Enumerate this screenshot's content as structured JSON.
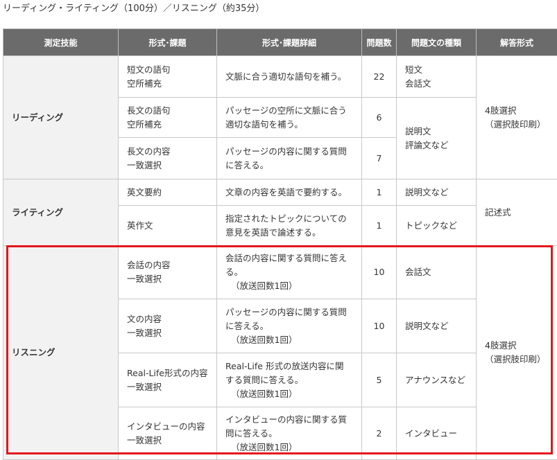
{
  "heading": "リーディング・ライティング（100分）／リスニング（約35分）",
  "columns": {
    "skill": "測定技能",
    "format": "形式･課題",
    "detail": "形式･課題詳細",
    "count": "問題数",
    "text_type": "問題文の種類",
    "answer": "解答形式"
  },
  "reading": {
    "skill": "リーディング",
    "answer_1": "4肢選択",
    "answer_2": "（選択肢印刷）",
    "rows": [
      {
        "format_1": "短文の語句",
        "format_2": "空所補充",
        "detail_1": "文脈に合う適切な語句を補う。",
        "count": "22",
        "type_1": "短文",
        "type_2": "会話文"
      },
      {
        "format_1": "長文の語句",
        "format_2": "空所補充",
        "detail_1": "パッセージの空所に文脈に合う",
        "detail_2": "適切な語句を補う。",
        "count": "6"
      },
      {
        "format_1": "長文の内容",
        "format_2": "一致選択",
        "detail_1": "パッセージの内容に関する質問",
        "detail_2": "に答える。",
        "count": "7"
      }
    ],
    "merged_type_1": "説明文",
    "merged_type_2": "評論文など"
  },
  "writing": {
    "skill": "ライティング",
    "answer": "記述式",
    "rows": [
      {
        "format_1": "英文要約",
        "detail_1": "文章の内容を英語で要約する。",
        "count": "1",
        "type_1": "説明文など"
      },
      {
        "format_1": "英作文",
        "detail_1": "指定されたトピックについての",
        "detail_2": "意見を英語で論述する。",
        "count": "1",
        "type_1": "トピックなど"
      }
    ]
  },
  "listening": {
    "skill": "リスニング",
    "answer_1": "4肢選択",
    "answer_2": "（選択肢印刷）",
    "rows": [
      {
        "format_1": "会話の内容",
        "format_2": "一致選択",
        "detail_1": "会話の内容に関する質問に答え",
        "detail_2": "る。",
        "detail_3": "（放送回数1回）",
        "count": "10",
        "type_1": "会話文"
      },
      {
        "format_1": "文の内容",
        "format_2": "一致選択",
        "detail_1": "パッセージの内容に関する質問",
        "detail_2": "に答える。",
        "detail_3": "（放送回数1回）",
        "count": "10",
        "type_1": "説明文など"
      },
      {
        "format_1": "Real-Life形式の内容",
        "format_2": "一致選択",
        "detail_1": "Real-Life 形式の放送内容に関",
        "detail_2": "する質問に答える。",
        "detail_3": "（放送回数1回）",
        "count": "5",
        "type_1": "アナウンスなど"
      },
      {
        "format_1": "インタビューの内容",
        "format_2": "一致選択",
        "detail_1": "インタビューの内容に関する質",
        "detail_2": "問に答える。",
        "detail_3": "（放送回数1回）",
        "count": "2",
        "type_1": "インタビュー"
      }
    ]
  },
  "colors": {
    "header_bg": "#6b6b6b",
    "skill_bg": "#f2f2f2",
    "highlight_border": "#e3151d"
  }
}
